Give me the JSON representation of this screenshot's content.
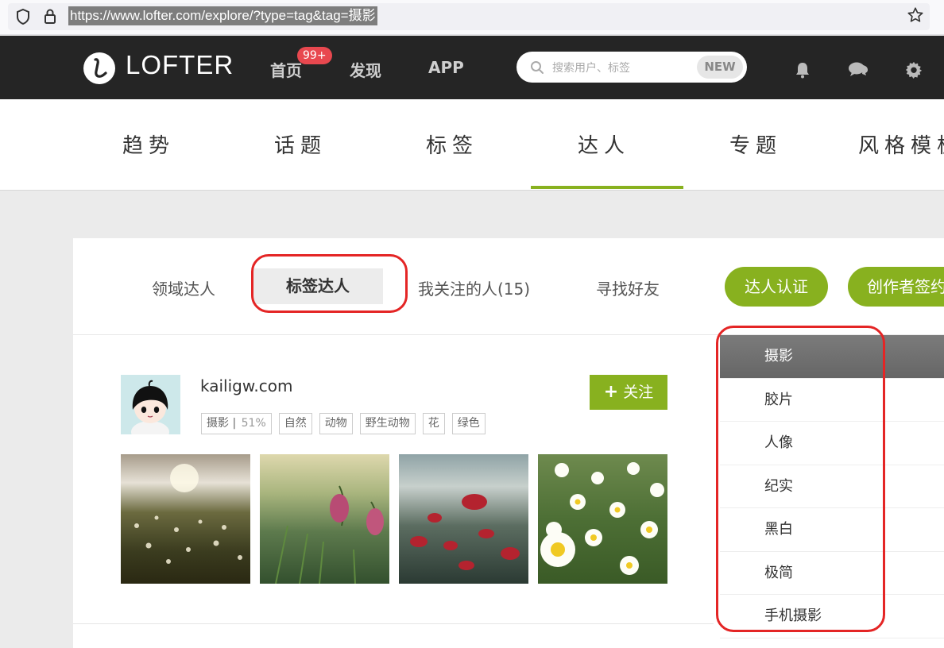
{
  "browser": {
    "url": "https://www.lofter.com/explore/?type=tag&tag=摄影"
  },
  "topnav": {
    "logo": "LOFTER",
    "items": [
      {
        "label": "首页"
      },
      {
        "label": "发现"
      },
      {
        "label": "APP"
      }
    ],
    "badge": "99+",
    "search_placeholder": "搜索用户、标签",
    "search_new": "NEW"
  },
  "subnav": {
    "tabs": [
      {
        "label": "趋势"
      },
      {
        "label": "话题"
      },
      {
        "label": "标签"
      },
      {
        "label": "达人"
      },
      {
        "label": "专题"
      },
      {
        "label": "风格模板"
      }
    ],
    "active": "达人"
  },
  "content_tabs": [
    {
      "label": "领域达人"
    },
    {
      "label": "标签达人"
    },
    {
      "label": "我关注的人(15)"
    },
    {
      "label": "寻找好友"
    }
  ],
  "buttons": {
    "certify": "达人认证",
    "creator": "创作者签约"
  },
  "user": {
    "name": "kailigw.com",
    "main_tag": "摄影",
    "main_tag_pct": "51%",
    "tags": [
      "自然",
      "动物",
      "野生动物",
      "花",
      "绿色"
    ],
    "follow_label": "关注"
  },
  "tag_list": [
    {
      "label": "摄影",
      "selected": true
    },
    {
      "label": "胶片"
    },
    {
      "label": "人像"
    },
    {
      "label": "纪实"
    },
    {
      "label": "黑白"
    },
    {
      "label": "极简"
    },
    {
      "label": "手机摄影"
    }
  ],
  "colors": {
    "accent": "#88b11f",
    "nav_bg": "#252525",
    "badge": "#e8484f",
    "annotation": "#e42525"
  }
}
